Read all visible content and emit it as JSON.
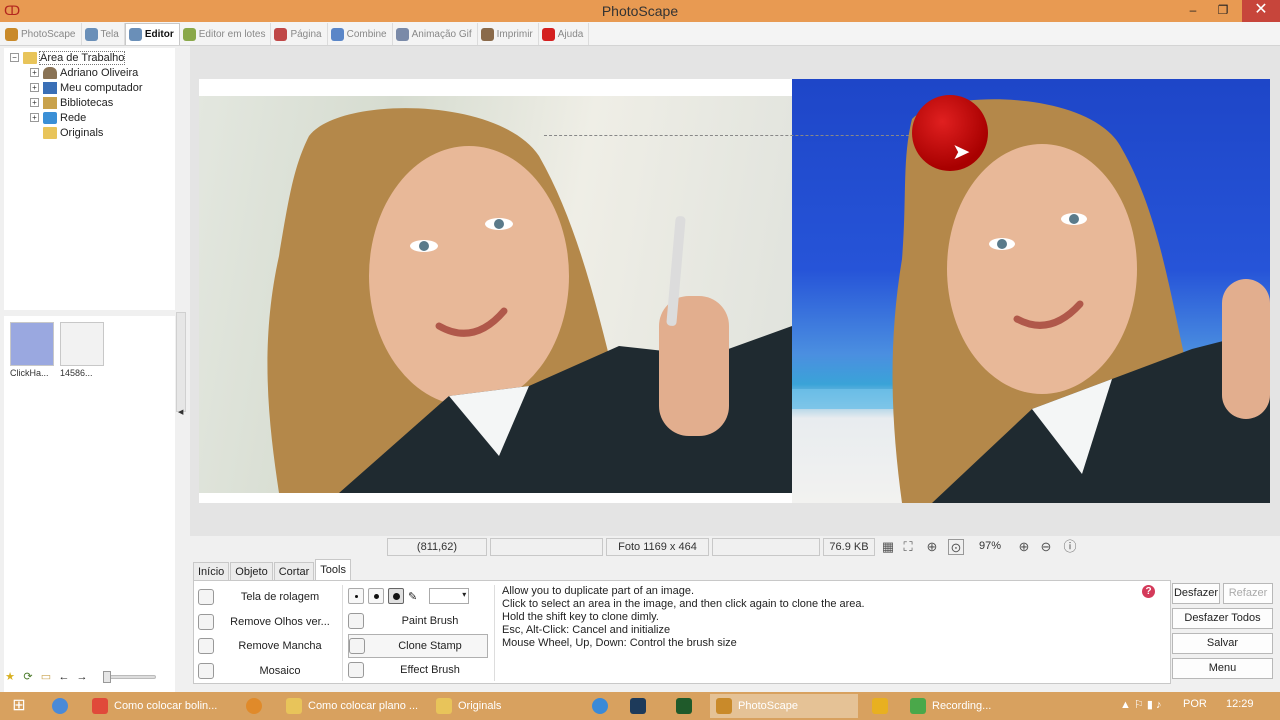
{
  "window": {
    "title": "PhotoScape",
    "minimize_label": "–",
    "restore_label": "❐",
    "close_label": "✕"
  },
  "menu": {
    "tabs": [
      {
        "label": "PhotoScape",
        "icon": "photoscape-icon",
        "color": "#c98a2a"
      },
      {
        "label": "Tela",
        "icon": "viewer-icon",
        "color": "#6a8fb8"
      },
      {
        "label": "Editor",
        "icon": "editor-icon",
        "color": "#6a8fb8"
      },
      {
        "label": "Editor em lotes",
        "icon": "batch-editor-icon",
        "color": "#8aa84a"
      },
      {
        "label": "Página",
        "icon": "page-icon",
        "color": "#c04848"
      },
      {
        "label": "Combine",
        "icon": "combine-icon",
        "color": "#5a86c8"
      },
      {
        "label": "Animação Gif",
        "icon": "animated-gif-icon",
        "color": "#7a8aa8"
      },
      {
        "label": "Imprimir",
        "icon": "print-icon",
        "color": "#8a6a4a"
      },
      {
        "label": "Ajuda",
        "icon": "help-icon",
        "color": "#d42020"
      }
    ],
    "active_index": 2
  },
  "tree": {
    "items": [
      {
        "label": "Área de Trabalho",
        "icon": "folder-icon",
        "level": 0,
        "expander": "−"
      },
      {
        "label": "Adriano Oliveira",
        "icon": "user-folder-icon",
        "level": 1,
        "expander": "+"
      },
      {
        "label": "Meu computador",
        "icon": "computer-icon",
        "level": 1,
        "expander": "+"
      },
      {
        "label": "Bibliotecas",
        "icon": "library-icon",
        "level": 1,
        "expander": "+"
      },
      {
        "label": "Rede",
        "icon": "network-icon",
        "level": 1,
        "expander": "+"
      },
      {
        "label": "Originals",
        "icon": "folder-icon",
        "level": 1,
        "expander": ""
      }
    ]
  },
  "thumbnails": [
    {
      "label": "ClickHa...",
      "color": "#9aa8e0"
    },
    {
      "label": "14586...",
      "color": "#f2f2f2"
    }
  ],
  "status": {
    "coords": "(811,62)",
    "photo_size": "Foto 1169 x 464",
    "file_size": "76.9 KB",
    "zoom": "97%"
  },
  "subtabs": [
    "Início",
    "Objeto",
    "Cortar",
    "Tools"
  ],
  "active_subtab": 3,
  "tools": {
    "col1": [
      {
        "label": "Tela de rolagem",
        "icon": "hand-icon"
      },
      {
        "label": "Remove Olhos ver...",
        "icon": "red-eye-icon"
      },
      {
        "label": "Remove Mancha",
        "icon": "blemish-icon"
      },
      {
        "label": "Mosaico",
        "icon": "mosaic-icon"
      }
    ],
    "col2": [
      {
        "label": "Paint Brush",
        "icon": "paint-brush-icon"
      },
      {
        "label": "Clone Stamp",
        "icon": "clone-stamp-icon"
      },
      {
        "label": "Effect Brush",
        "icon": "effect-brush-icon"
      }
    ],
    "active_col2_index": 1
  },
  "help_lines": [
    "Allow you to duplicate part of an image.",
    "Click to select an area in the image, and then click again to clone the area.",
    "Hold the shift key to clone dimly.",
    "Esc, Alt-Click: Cancel and initialize",
    "Mouse Wheel, Up, Down: Control the brush size"
  ],
  "buttons": {
    "undo": "Desfazer",
    "redo": "Refazer",
    "undo_all": "Desfazer Todos",
    "save": "Salvar",
    "menu": "Menu"
  },
  "taskbar": {
    "items": [
      {
        "label": "Como colocar bolin...",
        "icon": "chrome-icon",
        "color": "#e04a3a"
      },
      {
        "label": "Como colocar plano ...",
        "icon": "folder-icon",
        "color": "#e8c45a"
      },
      {
        "label": "Originals",
        "icon": "folder-icon",
        "color": "#e8c45a"
      },
      {
        "label": "PhotoScape",
        "icon": "photoscape-icon",
        "color": "#c98a2a"
      },
      {
        "label": "Recording...",
        "icon": "recorder-icon",
        "color": "#4aa84a"
      }
    ],
    "language": "POR",
    "time": "12:29"
  },
  "colors": {
    "titlebar": "#e89a52",
    "taskbar": "#d8a15f",
    "clone_cursor": "#c00000"
  }
}
